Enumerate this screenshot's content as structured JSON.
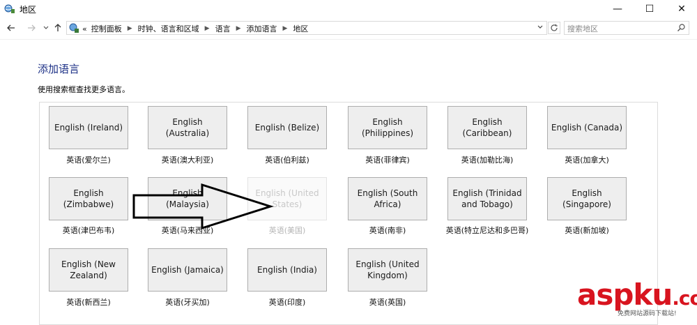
{
  "window": {
    "title": "地区",
    "controls": {
      "minimize": "—",
      "maximize": "☐",
      "close": "✕"
    }
  },
  "addressbar": {
    "lead": "«",
    "breadcrumbs": [
      "控制面板",
      "时钟、语言和区域",
      "语言",
      "添加语言",
      "地区"
    ],
    "search_placeholder": "搜索地区"
  },
  "main": {
    "title": "添加语言",
    "instruction": "使用搜索框查找更多语言。"
  },
  "languages": [
    {
      "label": "English (Ireland)",
      "caption": "英语(爱尔兰)",
      "enabled": true
    },
    {
      "label": "English (Australia)",
      "caption": "英语(澳大利亚)",
      "enabled": true
    },
    {
      "label": "English (Belize)",
      "caption": "英语(伯利兹)",
      "enabled": true
    },
    {
      "label": "English (Philippines)",
      "caption": "英语(菲律宾)",
      "enabled": true
    },
    {
      "label": "English (Caribbean)",
      "caption": "英语(加勒比海)",
      "enabled": true
    },
    {
      "label": "English (Canada)",
      "caption": "英语(加拿大)",
      "enabled": true
    },
    {
      "label": "English (Zimbabwe)",
      "caption": "英语(津巴布韦)",
      "enabled": true
    },
    {
      "label": "English (Malaysia)",
      "caption": "英语(马来西亚)",
      "enabled": true
    },
    {
      "label": "English (United States)",
      "caption": "英语(美国)",
      "enabled": false
    },
    {
      "label": "English (South Africa)",
      "caption": "英语(南非)",
      "enabled": true
    },
    {
      "label": "English (Trinidad and Tobago)",
      "caption": "英语(特立尼达和多巴哥)",
      "enabled": true
    },
    {
      "label": "English (Singapore)",
      "caption": "英语(新加坡)",
      "enabled": true
    },
    {
      "label": "English (New Zealand)",
      "caption": "英语(新西兰)",
      "enabled": true
    },
    {
      "label": "English (Jamaica)",
      "caption": "英语(牙买加)",
      "enabled": true
    },
    {
      "label": "English (India)",
      "caption": "英语(印度)",
      "enabled": true
    },
    {
      "label": "English (United Kingdom)",
      "caption": "英语(英国)",
      "enabled": true
    }
  ],
  "watermark": {
    "brand_a": "asp",
    "brand_b": "ku",
    "brand_c": ".com",
    "tagline": "免费网站源码下载站!"
  },
  "colors": {
    "title": "#1e3287",
    "watermark": "#d8141f"
  }
}
